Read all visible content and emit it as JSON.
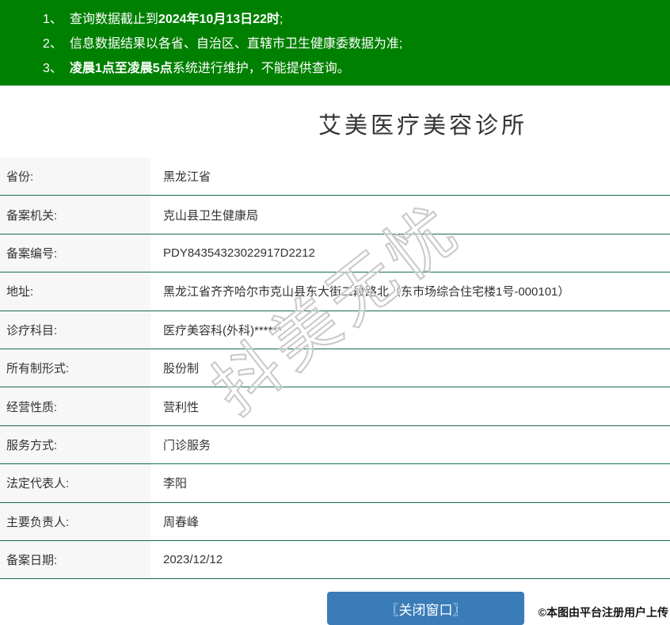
{
  "notices": [
    {
      "num": "1、",
      "segments": [
        {
          "text": "查询数据截止到",
          "bold": false
        },
        {
          "text": "2024年10月13日22时",
          "bold": true
        },
        {
          "text": ";",
          "bold": false
        }
      ]
    },
    {
      "num": "2、",
      "segments": [
        {
          "text": "信息数据结果以各省、自治区、直辖市卫生健康委数据为准;",
          "bold": false
        }
      ]
    },
    {
      "num": "3、",
      "segments": [
        {
          "text": "凌晨1点至凌晨5点",
          "bold": true
        },
        {
          "text": "系统进行维护，不能提供查询。",
          "bold": false
        }
      ]
    }
  ],
  "title": "艾美医疗美容诊所",
  "table": {
    "rows": [
      {
        "label": "省份:",
        "value": "黑龙江省"
      },
      {
        "label": "备案机关:",
        "value": "克山县卫生健康局"
      },
      {
        "label": "备案编号:",
        "value": "PDY84354323022917D2212"
      },
      {
        "label": "地址:",
        "value": "黑龙江省齐齐哈尔市克山县东大街二段路北（东市场综合住宅楼1号-000101）"
      },
      {
        "label": "诊疗科目:",
        "value": "医疗美容科(外科)******"
      },
      {
        "label": "所有制形式:",
        "value": "股份制"
      },
      {
        "label": "经营性质:",
        "value": "营利性"
      },
      {
        "label": "服务方式:",
        "value": "门诊服务"
      },
      {
        "label": "法定代表人:",
        "value": "李阳"
      },
      {
        "label": "主要负责人:",
        "value": "周春峰"
      },
      {
        "label": "备案日期:",
        "value": "2023/12/12"
      }
    ]
  },
  "watermark": "抖美无忧",
  "footer": {
    "close_button": "〖关闭窗口〗",
    "copyright": "©本图由平台注册用户上传"
  },
  "colors": {
    "banner_green": "#008000",
    "line_green": "#156e44",
    "label_bg": "#f7f7f7",
    "button_blue": "#3a7cb8",
    "text": "#333333"
  }
}
